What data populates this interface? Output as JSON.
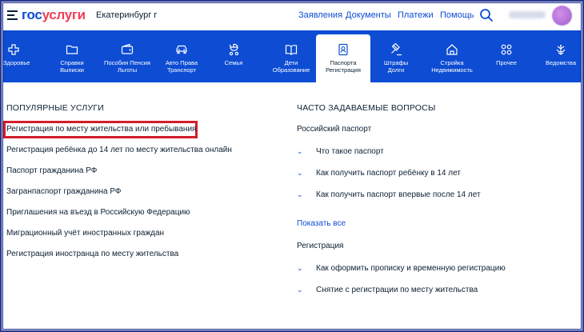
{
  "header": {
    "logo_part1": "гос",
    "logo_part2": "услуги",
    "city": "Екатеринбург г",
    "nav": [
      "Заявления",
      "Документы",
      "Платежи",
      "Помощь"
    ]
  },
  "categories": [
    {
      "label": "Здоровье",
      "icon": "plus-icon"
    },
    {
      "label": "Справки Выписки",
      "icon": "folder-icon"
    },
    {
      "label": "Пособия Пенсия Льготы",
      "icon": "wallet-icon"
    },
    {
      "label": "Авто Права Транспорт",
      "icon": "car-icon"
    },
    {
      "label": "Семья",
      "icon": "stroller-icon"
    },
    {
      "label": "Дети Образование",
      "icon": "book-icon"
    },
    {
      "label": "Паспорта Регистрация",
      "icon": "passport-icon",
      "active": true
    },
    {
      "label": "Штрафы Долги",
      "icon": "gavel-icon"
    },
    {
      "label": "Стройка Недвижимость",
      "icon": "house-icon"
    },
    {
      "label": "Прочее",
      "icon": "grid-icon"
    },
    {
      "label": "Ведомства",
      "icon": "emblem-icon"
    }
  ],
  "popular": {
    "title": "ПОПУЛЯРНЫЕ УСЛУГИ",
    "items": [
      "Регистрация по месту жительства или пребывания",
      "Регистрация ребёнка до 14 лет по месту жительства онлайн",
      "Паспорт гражданина РФ",
      "Загранпаспорт гражданина РФ",
      "Приглашения на въезд в Российскую Федерацию",
      "Миграционный учёт иностранных граждан",
      "Регистрация иностранца по месту жительства"
    ]
  },
  "faq": {
    "title": "ЧАСТО ЗАДАВАЕМЫЕ ВОПРОСЫ",
    "group1": "Российский паспорт",
    "group1_items": [
      "Что такое паспорт",
      "Как получить паспорт ребёнку в 14 лет",
      "Как получить паспорт впервые после 14 лет"
    ],
    "show_all": "Показать все",
    "group2": "Регистрация",
    "group2_items": [
      "Как оформить прописку и временную регистрацию",
      "Снятие с регистрации по месту жительства"
    ]
  },
  "colors": {
    "brand_blue": "#0d4cd3",
    "brand_red": "#ee3f58",
    "highlight": "#d21e2b"
  }
}
